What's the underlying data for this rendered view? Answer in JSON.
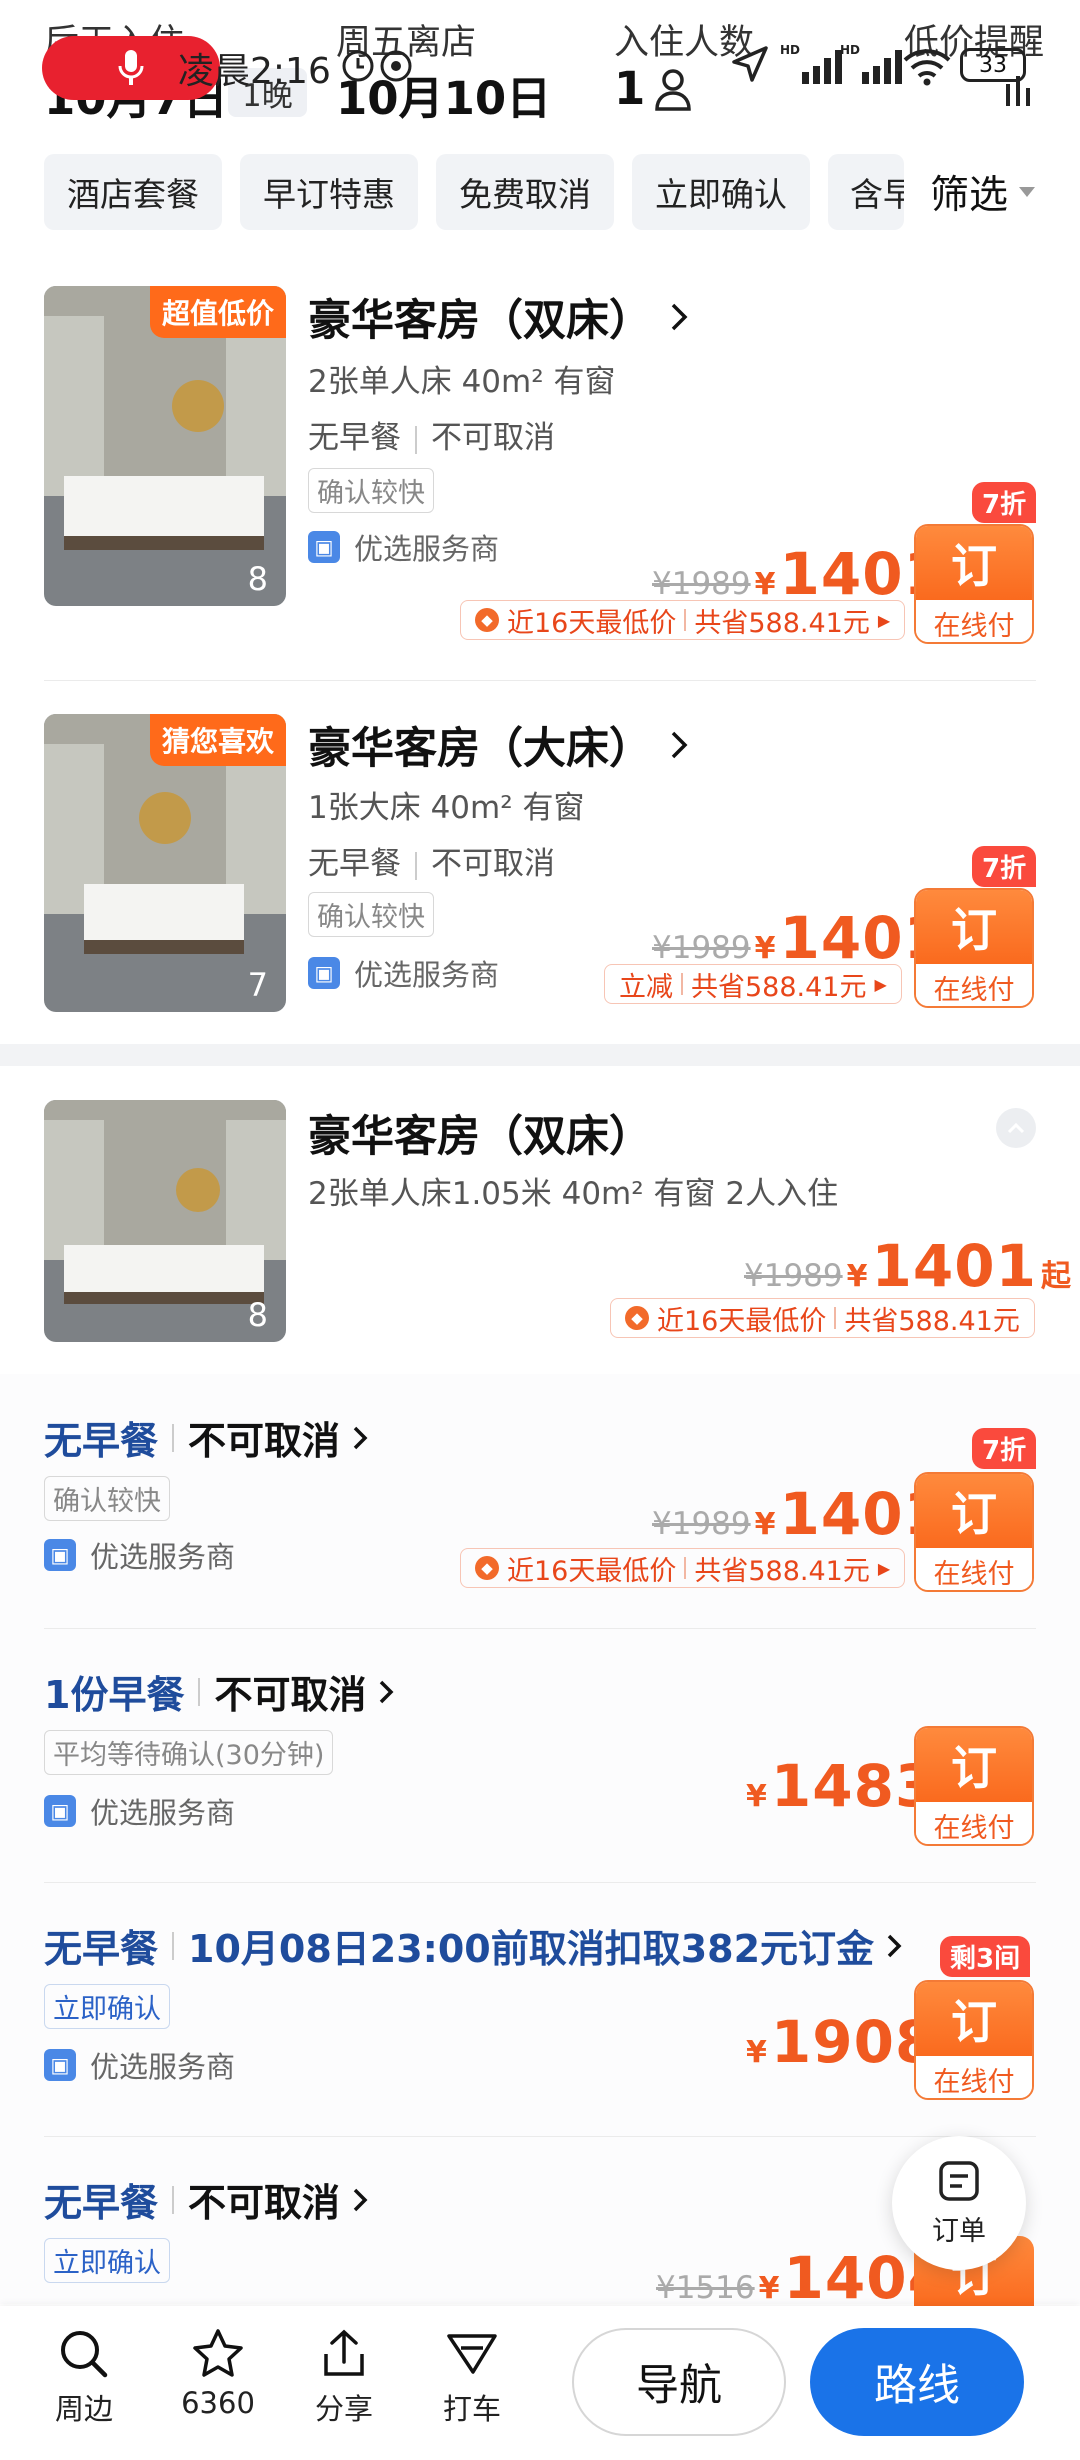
{
  "status_bar": {
    "time": "凌晨2:16",
    "battery": "33"
  },
  "header": {
    "checkin_label": "后天入住",
    "checkin_date": "10月7日",
    "nights": "1晚",
    "checkout_label": "周五离店",
    "checkout_date": "10月10日",
    "guests_label": "入住人数",
    "guests": "1",
    "alert_label": "低价提醒"
  },
  "filters": {
    "chips": [
      "酒店套餐",
      "早订特惠",
      "免费取消",
      "立即确认",
      "含早"
    ],
    "filter_label": "筛选"
  },
  "rooms": [
    {
      "badge": "超值低价",
      "title": "豪华客房（双床）",
      "beds": "2张单人床  40m²  有窗",
      "breakfast": "无早餐",
      "cancel": "不可取消",
      "confirm": "确认较快",
      "provider": "优选服务商",
      "photos": "8",
      "discount": "7折",
      "old_price": "¥1989",
      "price": "1401",
      "saving_a": "近16天最低价",
      "saving_b": "共省588.41元",
      "book": "订",
      "pay": "在线付"
    },
    {
      "badge": "猜您喜欢",
      "title": "豪华客房（大床）",
      "beds": "1张大床  40m²  有窗",
      "breakfast": "无早餐",
      "cancel": "不可取消",
      "confirm": "确认较快",
      "provider": "优选服务商",
      "photos": "7",
      "discount": "7折",
      "old_price": "¥1989",
      "price": "1401",
      "saving_a": "立减",
      "saving_b": "共省588.41元",
      "book": "订",
      "pay": "在线付"
    }
  ],
  "expanded": {
    "title": "豪华客房（双床）",
    "beds": "2张单人床1.05米  40m²  有窗  2人入住",
    "photos": "8",
    "old_price": "¥1989",
    "price": "1401",
    "suffix": "起",
    "saving_a": "近16天最低价",
    "saving_b": "共省588.41元",
    "rates": [
      {
        "breakfast": "无早餐",
        "cancel": "不可取消",
        "tag": "确认较快",
        "provider": "优选服务商",
        "discount": "7折",
        "old_price": "¥1989",
        "price": "1401",
        "saving_a": "近16天最低价",
        "saving_b": "共省588.41元",
        "book": "订",
        "pay": "在线付"
      },
      {
        "breakfast": "1份早餐",
        "cancel": "不可取消",
        "tag": "平均等待确认(30分钟)",
        "provider": "优选服务商",
        "price": "1483",
        "book": "订",
        "pay": "在线付"
      },
      {
        "breakfast": "无早餐",
        "cancel": "10月08日23:00前取消扣取382元订金",
        "tag": "立即确认",
        "provider": "优选服务商",
        "discount": "剩3间",
        "price": "1908",
        "book": "订",
        "pay": "在线付"
      },
      {
        "breakfast": "无早餐",
        "cancel": "不可取消",
        "tag": "立即确认",
        "old_price": "¥1516",
        "price": "1404",
        "book": "订"
      }
    ]
  },
  "float_order": "订单",
  "bottom_bar": {
    "nearby": "周边",
    "favorites": "6360",
    "share": "分享",
    "taxi": "打车",
    "navigate": "导航",
    "route": "路线"
  },
  "colors": {
    "accent": "#f05a20",
    "blue": "#1f4c9c",
    "route_btn": "#1a73e8",
    "record": "#e8212f"
  }
}
